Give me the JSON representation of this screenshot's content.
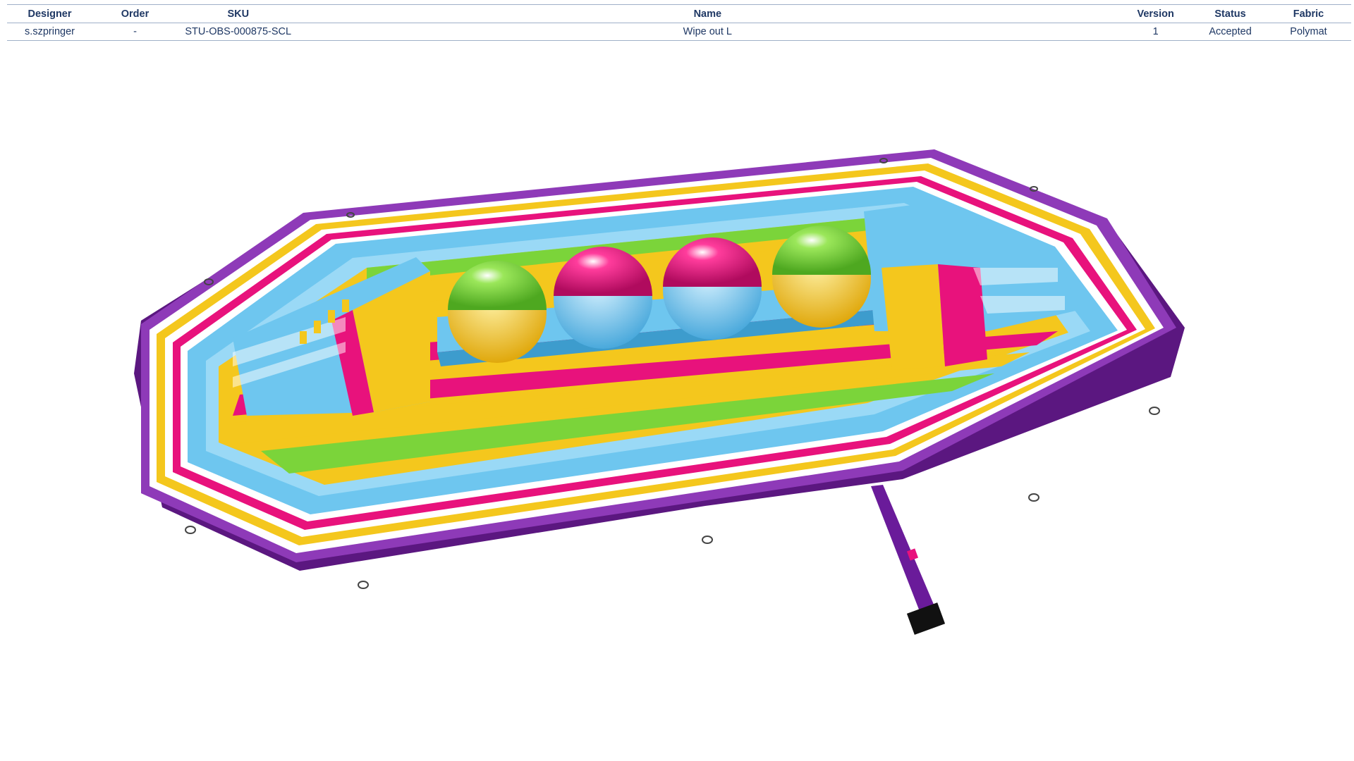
{
  "table": {
    "headers": {
      "designer": "Designer",
      "order": "Order",
      "sku": "SKU",
      "name": "Name",
      "version": "Version",
      "status": "Status",
      "fabric": "Fabric"
    },
    "row": {
      "designer": "s.szpringer",
      "order": "-",
      "sku": "STU-OBS-000875-SCL",
      "name": "Wipe out L",
      "version": "1",
      "status": "Accepted",
      "fabric": "Polymat"
    }
  },
  "render": {
    "description_icon": "inflatable-obstacle-course-render",
    "colors": {
      "purple": "#6a1b9a",
      "blue": "#6ec6ef",
      "yellow": "#f4c71d",
      "pink": "#e8127c",
      "green": "#7bd43a"
    }
  }
}
